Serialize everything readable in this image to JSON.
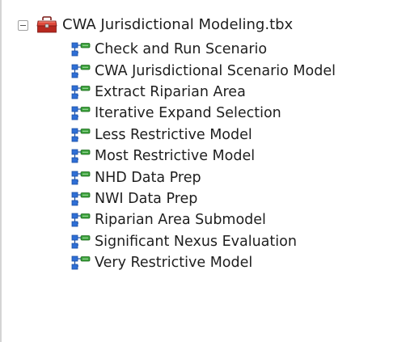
{
  "toolbox": {
    "name": "CWA Jurisdictional Modeling.tbx",
    "icon": "toolbox-icon",
    "expander": "collapse-icon"
  },
  "tools": [
    {
      "label": "Check and Run Scenario",
      "icon": "model-tool-icon"
    },
    {
      "label": "CWA Jurisdictional Scenario Model",
      "icon": "model-tool-icon"
    },
    {
      "label": "Extract Riparian Area",
      "icon": "model-tool-icon"
    },
    {
      "label": "Iterative Expand Selection",
      "icon": "model-tool-icon"
    },
    {
      "label": "Less Restrictive Model",
      "icon": "model-tool-icon"
    },
    {
      "label": "Most Restrictive Model",
      "icon": "model-tool-icon"
    },
    {
      "label": "NHD Data Prep",
      "icon": "model-tool-icon"
    },
    {
      "label": "NWI Data Prep",
      "icon": "model-tool-icon"
    },
    {
      "label": "Riparian Area Submodel",
      "icon": "model-tool-icon"
    },
    {
      "label": "Significant Nexus Evaluation",
      "icon": "model-tool-icon"
    },
    {
      "label": "Very Restrictive Model",
      "icon": "model-tool-icon"
    }
  ],
  "colors": {
    "model_blue": "#2f6fd6",
    "model_green": "#3aa13a",
    "toolbox_red": "#c8332c"
  }
}
